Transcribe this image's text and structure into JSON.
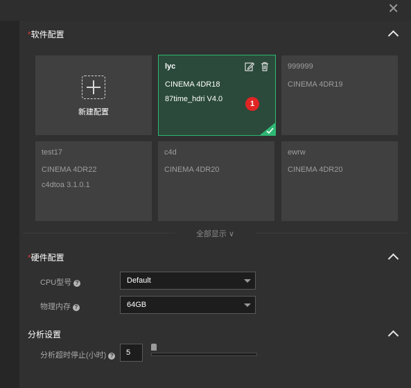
{
  "dialog": {
    "close_glyph": "✕"
  },
  "software": {
    "title": "软件配置",
    "required_mark": "*",
    "new_label": "新建配置",
    "cards": [
      {
        "name": "lyc",
        "lines": [
          "CINEMA 4DR18",
          "87time_hdri V4.0"
        ],
        "badge": "1",
        "active": true
      },
      {
        "name": "999999",
        "lines": [
          "CINEMA 4DR19"
        ]
      },
      {
        "name": "test17",
        "lines": [
          "CINEMA 4DR22",
          "c4dtoa 3.1.0.1"
        ]
      },
      {
        "name": "c4d",
        "lines": [
          "CINEMA 4DR20"
        ]
      },
      {
        "name": "ewrw",
        "lines": [
          "CINEMA 4DR20"
        ]
      }
    ],
    "show_all": "全部显示 ∨"
  },
  "hardware": {
    "title": "硬件配置",
    "required_mark": "*",
    "cpu_label": "CPU型号",
    "cpu_value": "Default",
    "memory_label": "物理内存",
    "memory_value": "64GB"
  },
  "analysis": {
    "title": "分析设置",
    "timeout_label": "分析超时停止(小时)",
    "timeout_value": "5",
    "help_glyph": "?"
  },
  "colors": {
    "accent": "#2fb873",
    "active_card": "#2b4a3b",
    "badge": "#e02424",
    "required": "#d63b3b"
  }
}
